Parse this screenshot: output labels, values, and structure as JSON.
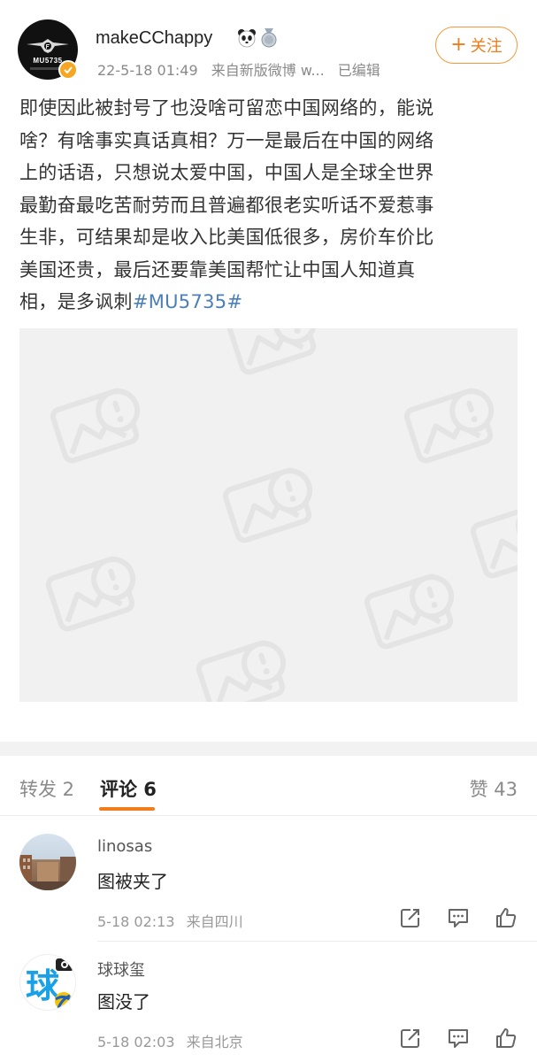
{
  "post": {
    "author": {
      "name": "makeCChappy",
      "avatar_text": "MU5735",
      "badges": [
        "panda-icon",
        "medal-icon"
      ],
      "verified": true
    },
    "meta": {
      "time": "22-5-18 01:49",
      "source": "来自新版微博 w...",
      "edited": "已编辑"
    },
    "follow_button": {
      "plus": "+",
      "label": "关注"
    },
    "text_lines": [
      "即使因此被封号了也没啥可留恋中国网络的，能说",
      "啥？有啥事实真话真相？万一是最后在中国的网络",
      "上的话语，只想说太爱中国，中国人是全球全世界",
      "最勤奋最吃苦耐劳而且普遍都很老实听话不爱惹事",
      "生非，可结果却是收入比美国低很多，房价车价比",
      "美国还贵，最后还要靠美国帮忙让中国人知道真"
    ],
    "last_line": "相，是多讽刺",
    "hashtag": "#MU5735#",
    "image_state": "image-unavailable-placeholder"
  },
  "tabs": {
    "repost": "转发 2",
    "comments": "评论 6",
    "likes": "赞 43",
    "active": "comments",
    "accent_color": "#f07c1b"
  },
  "comments": [
    {
      "name": "linosas",
      "text": "图被夹了",
      "time": "5-18 02:13",
      "location": "来自四川"
    },
    {
      "name": "球球玺",
      "avatar_text": "球",
      "text": "图没了",
      "time": "5-18 02:03",
      "location": "来自北京"
    }
  ],
  "colors": {
    "link": "#4b7fb8",
    "accent": "#f07c1b",
    "verified": "#f5a623"
  }
}
